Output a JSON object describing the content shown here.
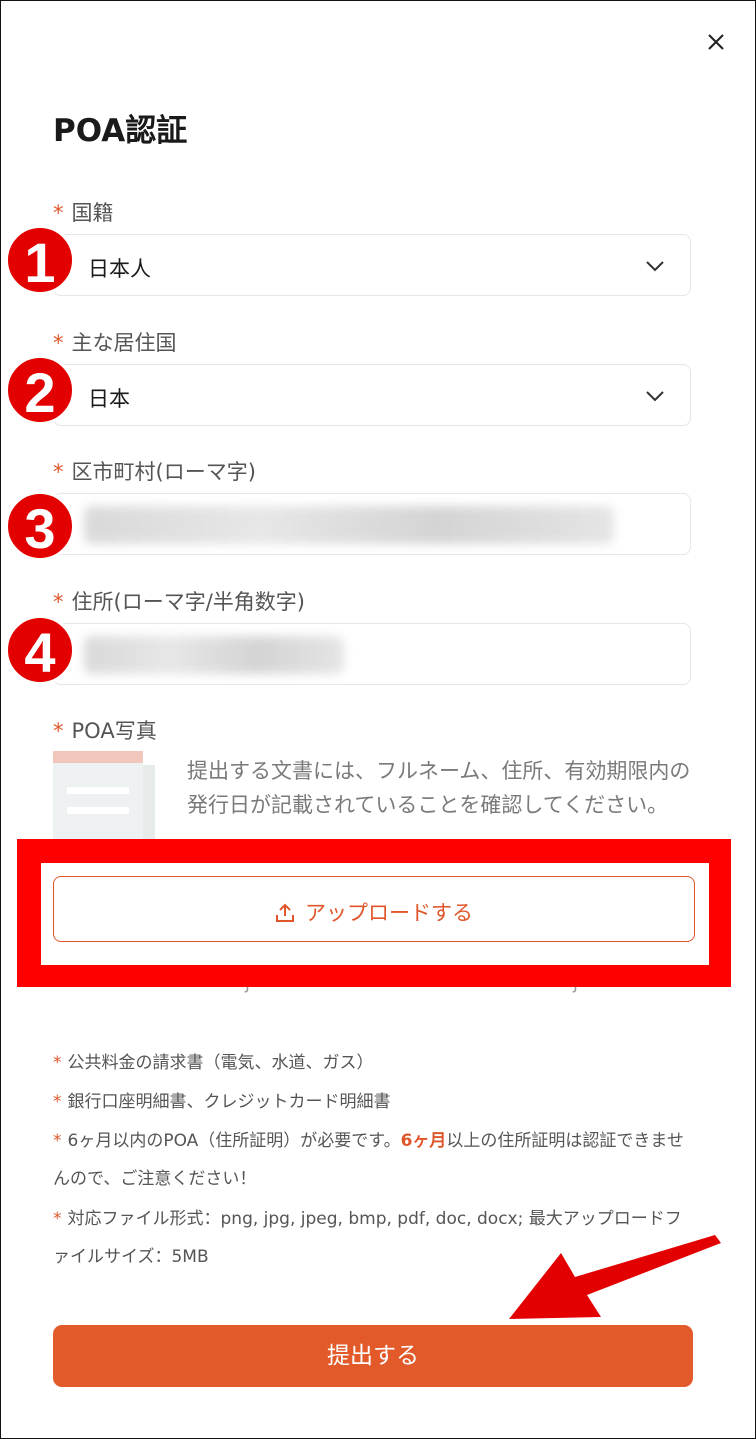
{
  "page": {
    "title": "POA認証"
  },
  "annotations": {
    "step1": "1",
    "step2": "2",
    "step3": "3",
    "step4": "4"
  },
  "form": {
    "required_mark": "*",
    "nationality": {
      "label": "国籍",
      "value": "日本人"
    },
    "residence_country": {
      "label": "主な居住国",
      "value": "日本"
    },
    "city": {
      "label": "区市町村(ローマ字)",
      "value": ""
    },
    "address": {
      "label": "住所(ローマ字/半角数字)",
      "value": ""
    },
    "poa_photo": {
      "label": "POA写真",
      "description": "提出する文書には、フルネーム、住所、有効期限内の発行日が記載されていることを確認してください。",
      "upload_label": "アップロードする"
    }
  },
  "hints": {
    "bullet": "*",
    "line1": "公共料金の請求書（電気、水道、ガス）",
    "line2": "銀行口座明細書、クレジットカード明細書",
    "line3_pre": "6ヶ月以内のPOA（住所証明）が必要です。",
    "line3_hl": "6ヶ月",
    "line3_post": "以上の住所証明は認証できませんので、ご注意ください！",
    "line4": "対応ファイル形式：png, jpg, jpeg, bmp, pdf, doc, docx; 最大アップロードファイルサイズ：5MB"
  },
  "actions": {
    "submit_label": "提出する"
  },
  "colors": {
    "accent": "#e35a2a",
    "annotation_red": "#e30000"
  },
  "icons": {
    "close": "close-icon",
    "chevron": "chevron-down-icon",
    "upload": "upload-icon",
    "document": "document-icon",
    "arrow": "arrow-annotation"
  }
}
